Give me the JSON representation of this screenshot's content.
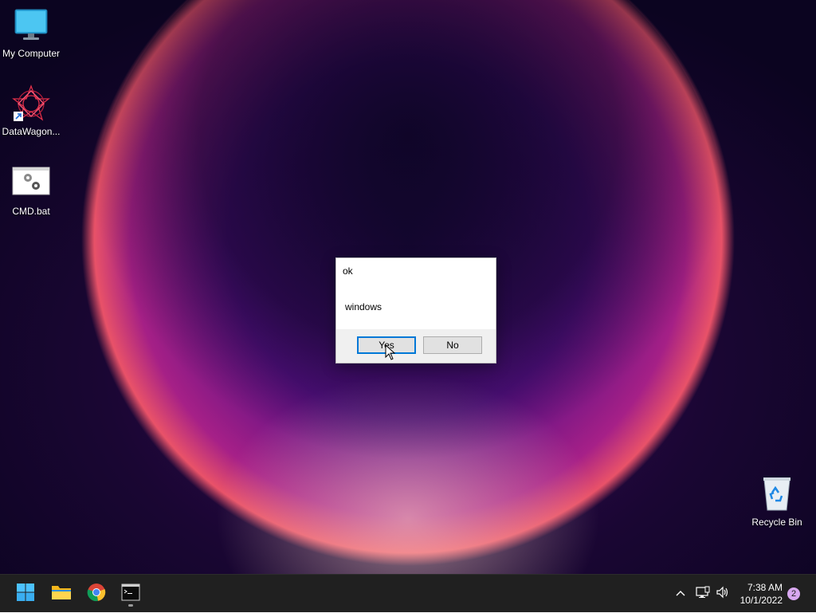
{
  "desktop": {
    "icons": [
      {
        "label": "My Computer",
        "icon": "monitor-icon"
      },
      {
        "label": "DataWagon...",
        "icon": "datawagon-shortcut-icon"
      },
      {
        "label": "CMD.bat",
        "icon": "batch-file-icon"
      },
      {
        "label": "Recycle Bin",
        "icon": "recycle-bin-icon"
      }
    ]
  },
  "dialog": {
    "title": "ok",
    "message": "windows",
    "yes_label": "Yes",
    "no_label": "No"
  },
  "taskbar": {
    "apps": [
      {
        "name": "start",
        "icon": "windows-start-icon"
      },
      {
        "name": "file-explorer",
        "icon": "folder-icon"
      },
      {
        "name": "chrome",
        "icon": "chrome-icon"
      },
      {
        "name": "terminal",
        "icon": "terminal-icon"
      }
    ],
    "time": "7:38 AM",
    "date": "10/1/2022",
    "notification_count": "2"
  },
  "colors": {
    "accent": "#0078d7",
    "taskbar_bg": "#202020",
    "badge": "#d8a8f0"
  }
}
